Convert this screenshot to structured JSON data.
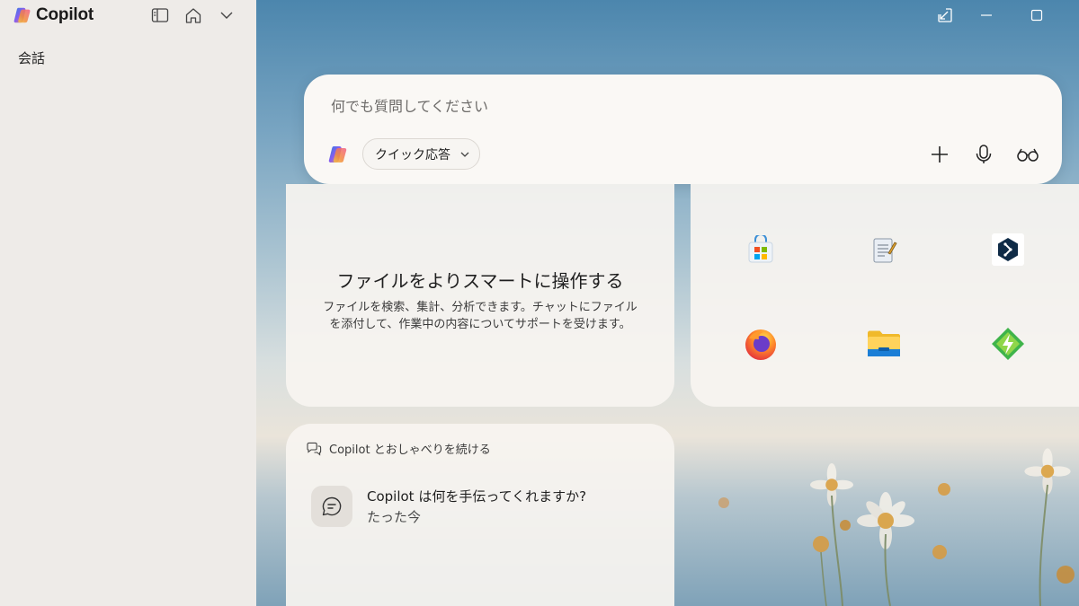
{
  "app": {
    "name": "Copilot"
  },
  "sidebar": {
    "section_label": "会話"
  },
  "composer": {
    "placeholder": "何でも質問してください",
    "mode_label": "クイック応答"
  },
  "files_card": {
    "title": "ファイルをよりスマートに操作する",
    "description_line1": "ファイルを検索、集計、分析できます。チャットにファイル",
    "description_line2": "を添付して、作業中の内容についてサポートを受けます。"
  },
  "apps_card": {
    "apps": [
      "microsoft-store",
      "notepad",
      "deepl",
      "firefox",
      "file-explorer",
      "app-launcher"
    ]
  },
  "chat_card": {
    "header": "Copilot とおしゃべりを続ける",
    "items": [
      {
        "title": "Copilot は何を手伝ってくれますか?",
        "time": "たった今"
      }
    ]
  },
  "colors": {
    "accent_blue": "#4c86ad",
    "card_bg": "#f7f4f0",
    "sidebar_bg": "#eeebe8"
  }
}
